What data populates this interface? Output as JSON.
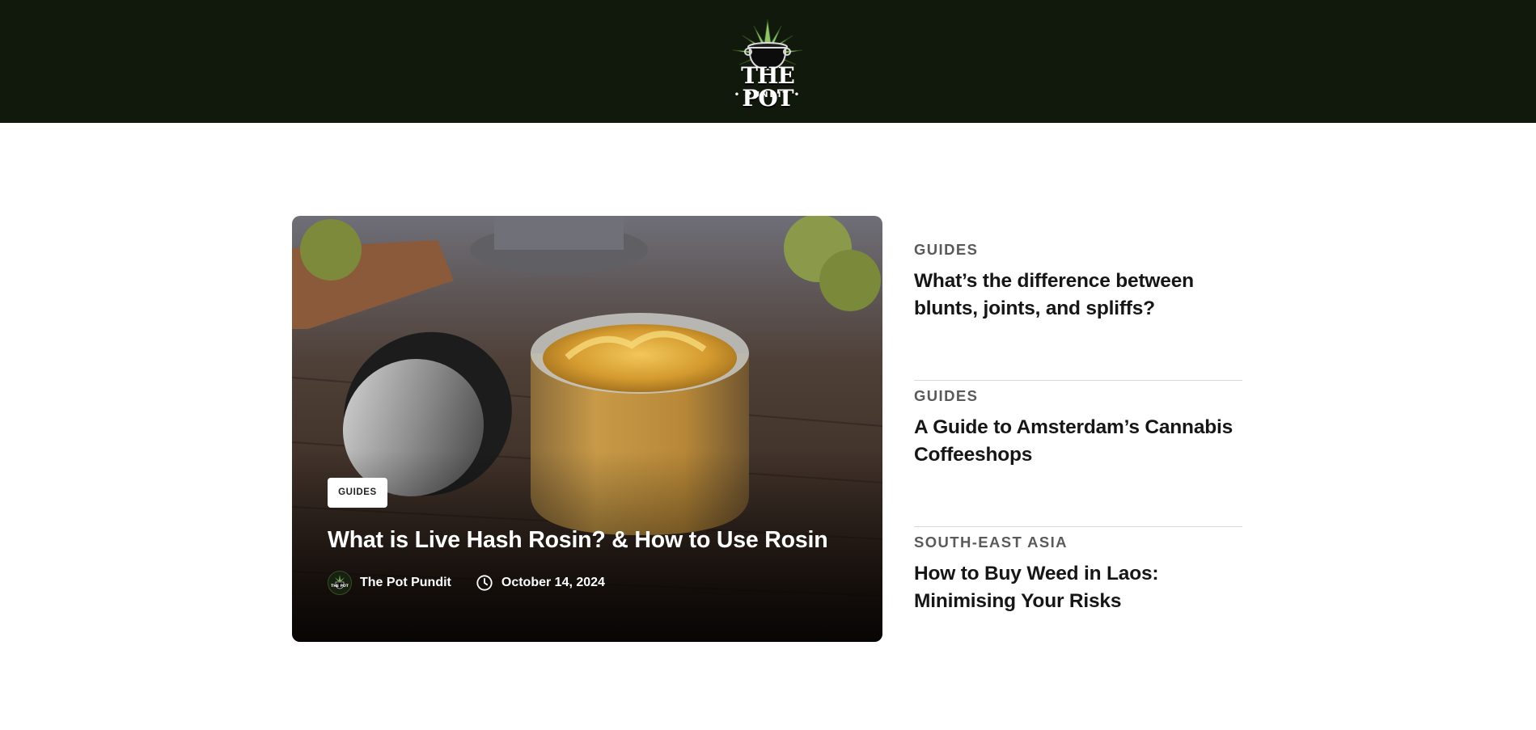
{
  "header": {
    "logo_title": "THE POT",
    "logo_subtitle": "• PUNDIT •",
    "background": "#11190c"
  },
  "featured": {
    "category": "GUIDES",
    "title": "What is Live Hash Rosin? & How to Use Rosin",
    "author": "The Pot Pundit",
    "date": "October 14, 2024",
    "avatar_icon": "pot-pundit-logo-icon",
    "date_icon": "clock-icon"
  },
  "sidebar": {
    "items": [
      {
        "category": "GUIDES",
        "title": "What’s the difference between blunts, joints, and spliffs?"
      },
      {
        "category": "GUIDES",
        "title": "A Guide to Amsterdam’s Cannabis Coffeeshops"
      },
      {
        "category": "SOUTH-EAST ASIA",
        "title": "How to Buy Weed in Laos: Minimising Your Risks"
      }
    ]
  },
  "colors": {
    "header_bg": "#11190c",
    "text_dark": "#161616",
    "category_gray": "#5a5a5a",
    "divider": "#d9d9d9"
  }
}
